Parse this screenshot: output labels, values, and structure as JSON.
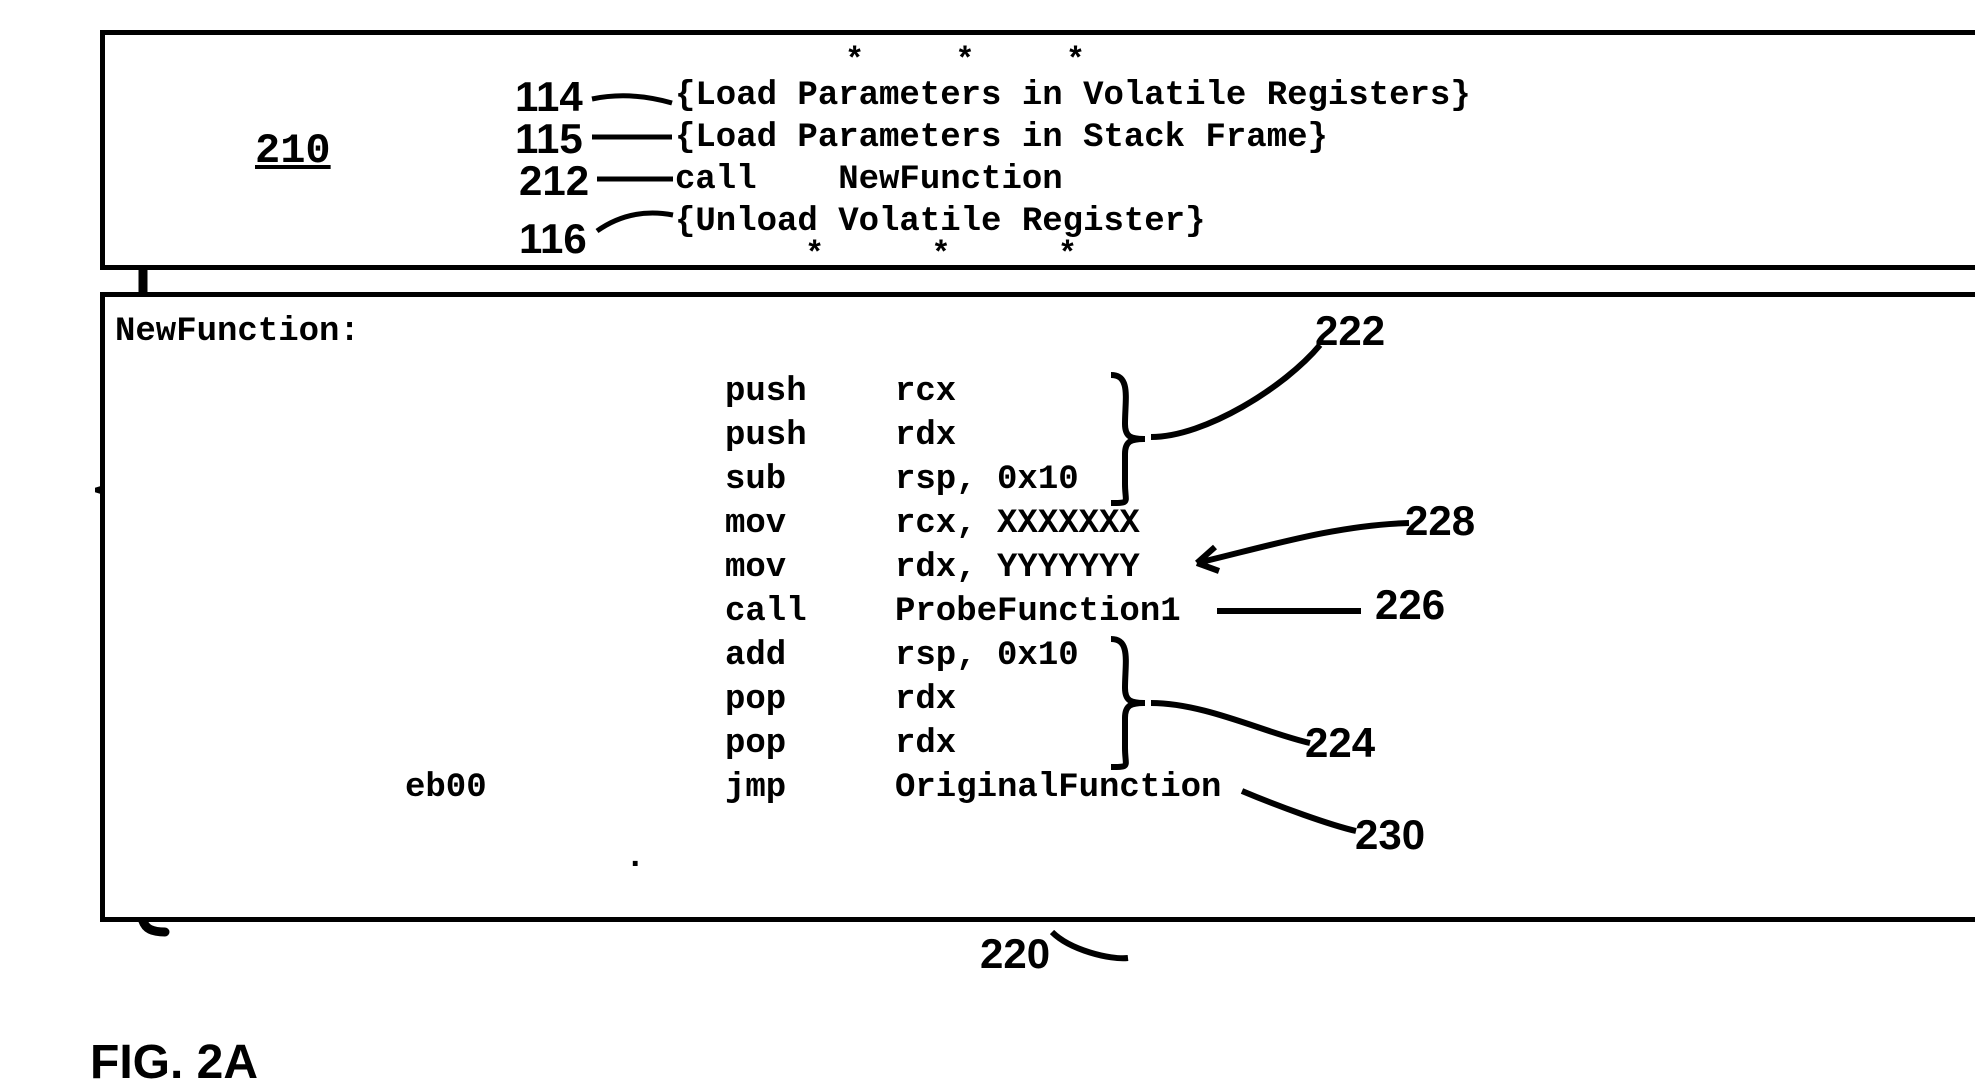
{
  "figure_label": "FIG. 2A",
  "top_box": {
    "id_label": "210",
    "stars": "* * *",
    "lines": [
      {
        "ref": "114",
        "text": "{Load Parameters in Volatile Registers}"
      },
      {
        "ref": "115",
        "text": "{Load Parameters in Stack Frame}"
      },
      {
        "ref": "212",
        "text": "call    NewFunction"
      },
      {
        "ref": "116",
        "text": "{Unload Volatile Register}"
      }
    ],
    "stars_bottom": "*   *   *"
  },
  "bottom_box": {
    "id_label": "220",
    "func_label": "NewFunction:",
    "eb00": "eb00",
    "instructions": [
      {
        "op": "push",
        "args": "rcx"
      },
      {
        "op": "push",
        "args": "rdx"
      },
      {
        "op": "sub",
        "args": "rsp, 0x10"
      },
      {
        "op": "mov",
        "args": "rcx, XXXXXXX"
      },
      {
        "op": "mov",
        "args": "rdx, YYYYYYY"
      },
      {
        "op": "call",
        "args": "ProbeFunction1"
      },
      {
        "op": "add",
        "args": "rsp, 0x10"
      },
      {
        "op": "pop",
        "args": "rdx"
      },
      {
        "op": "pop",
        "args": "rdx"
      },
      {
        "op": "jmp",
        "args": "OriginalFunction"
      }
    ],
    "refs": {
      "r222": "222",
      "r228": "228",
      "r226": "226",
      "r224": "224",
      "r230": "230"
    }
  }
}
